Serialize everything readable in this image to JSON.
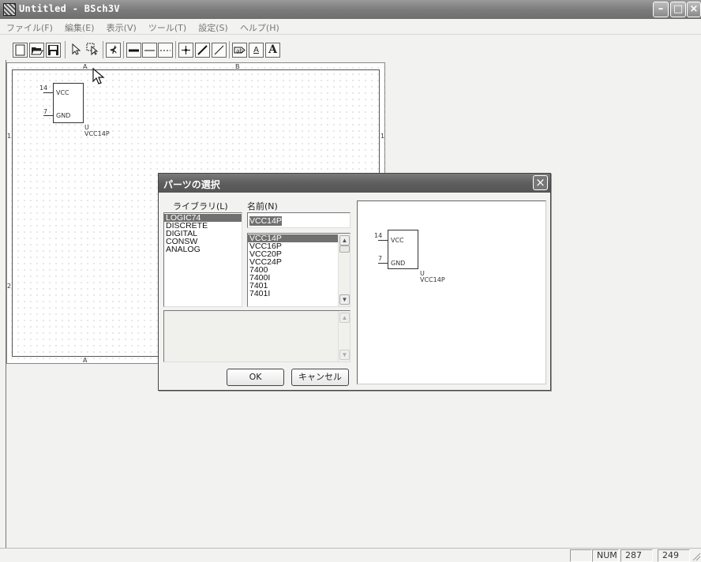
{
  "window": {
    "title": "Untitled - BSch3V"
  },
  "menu": [
    "ファイル(F)",
    "編集(E)",
    "表示(V)",
    "ツール(T)",
    "設定(S)",
    "ヘルプ(H)"
  ],
  "toolbar": {
    "buttons": [
      "new-file-icon",
      "open-folder-icon",
      "save-icon",
      "select-arrow-icon",
      "select-drag-icon",
      "part-place-icon",
      "wire-icon",
      "bus-icon",
      "dashed-line-icon",
      "junction-icon",
      "entry-icon",
      "line-icon",
      "tag-icon",
      "label-icon",
      "comment-icon"
    ],
    "glyph_part": "⊀",
    "glyph_label": "A",
    "glyph_comment": "A"
  },
  "canvas": {
    "col_a_top": "A",
    "col_b_top": "B",
    "col_a_bottom": "A",
    "row_1_left": "1",
    "row_1_right": "1",
    "row_2_left": "2",
    "symbol": {
      "pin_top_num": "14",
      "pin_top_name": "VCC",
      "pin_bottom_num": "7",
      "pin_bottom_name": "GND",
      "ref": "U",
      "part_name": "VCC14P"
    }
  },
  "dialog": {
    "title": "パーツの選択",
    "library_label": "ライブラリ(L)",
    "name_label": "名前(N)",
    "name_value": "VCC14P",
    "libraries": [
      "LOGIC74",
      "DISCRETE",
      "DIGITAL",
      "CONSW",
      "ANALOG"
    ],
    "selected_library": "LOGIC74",
    "parts": [
      "VCC14P",
      "VCC16P",
      "VCC20P",
      "VCC24P",
      "7400",
      "7400I",
      "7401",
      "7401I"
    ],
    "selected_part": "VCC14P",
    "ok_label": "OK",
    "cancel_label": "キャンセル",
    "preview": {
      "pin_top_num": "14",
      "pin_top_name": "VCC",
      "pin_bottom_num": "7",
      "pin_bottom_name": "GND",
      "ref": "U",
      "part_name": "VCC14P"
    }
  },
  "status": {
    "num": "NUM",
    "x": "287",
    "y": "249"
  }
}
